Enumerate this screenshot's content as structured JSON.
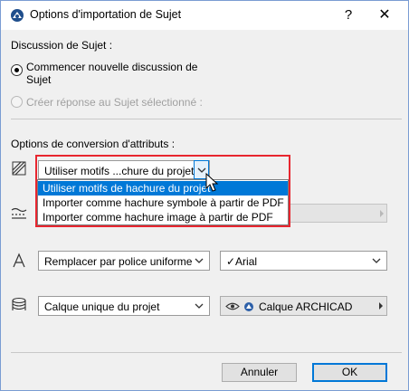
{
  "window": {
    "title": "Options d'importation de Sujet",
    "help": "?",
    "close": "✕"
  },
  "discussion": {
    "heading": "Discussion de Sujet :",
    "option_new": "Commencer nouvelle discussion de",
    "option_new_line2": "Sujet",
    "option_reply": "Créer réponse au Sujet sélectionné :"
  },
  "conversion": {
    "heading": "Options de conversion d'attributs :",
    "hatch_combo_value": "Utiliser motifs ...chure du projet",
    "hatch_options": [
      "Utiliser motifs de hachure du projet",
      "Importer comme hachure symbole à partir de PDF",
      "Importer comme hachure image à partir de PDF"
    ],
    "font_combo_value": "Remplacer par police uniforme",
    "font_name_value": "✓Arial",
    "layer_combo_value": "Calque unique du projet",
    "layer_name_value": "Calque ARCHICAD"
  },
  "buttons": {
    "cancel": "Annuler",
    "ok": "OK"
  },
  "colors": {
    "highlight": "#e8262f",
    "selection": "#0078d7"
  }
}
